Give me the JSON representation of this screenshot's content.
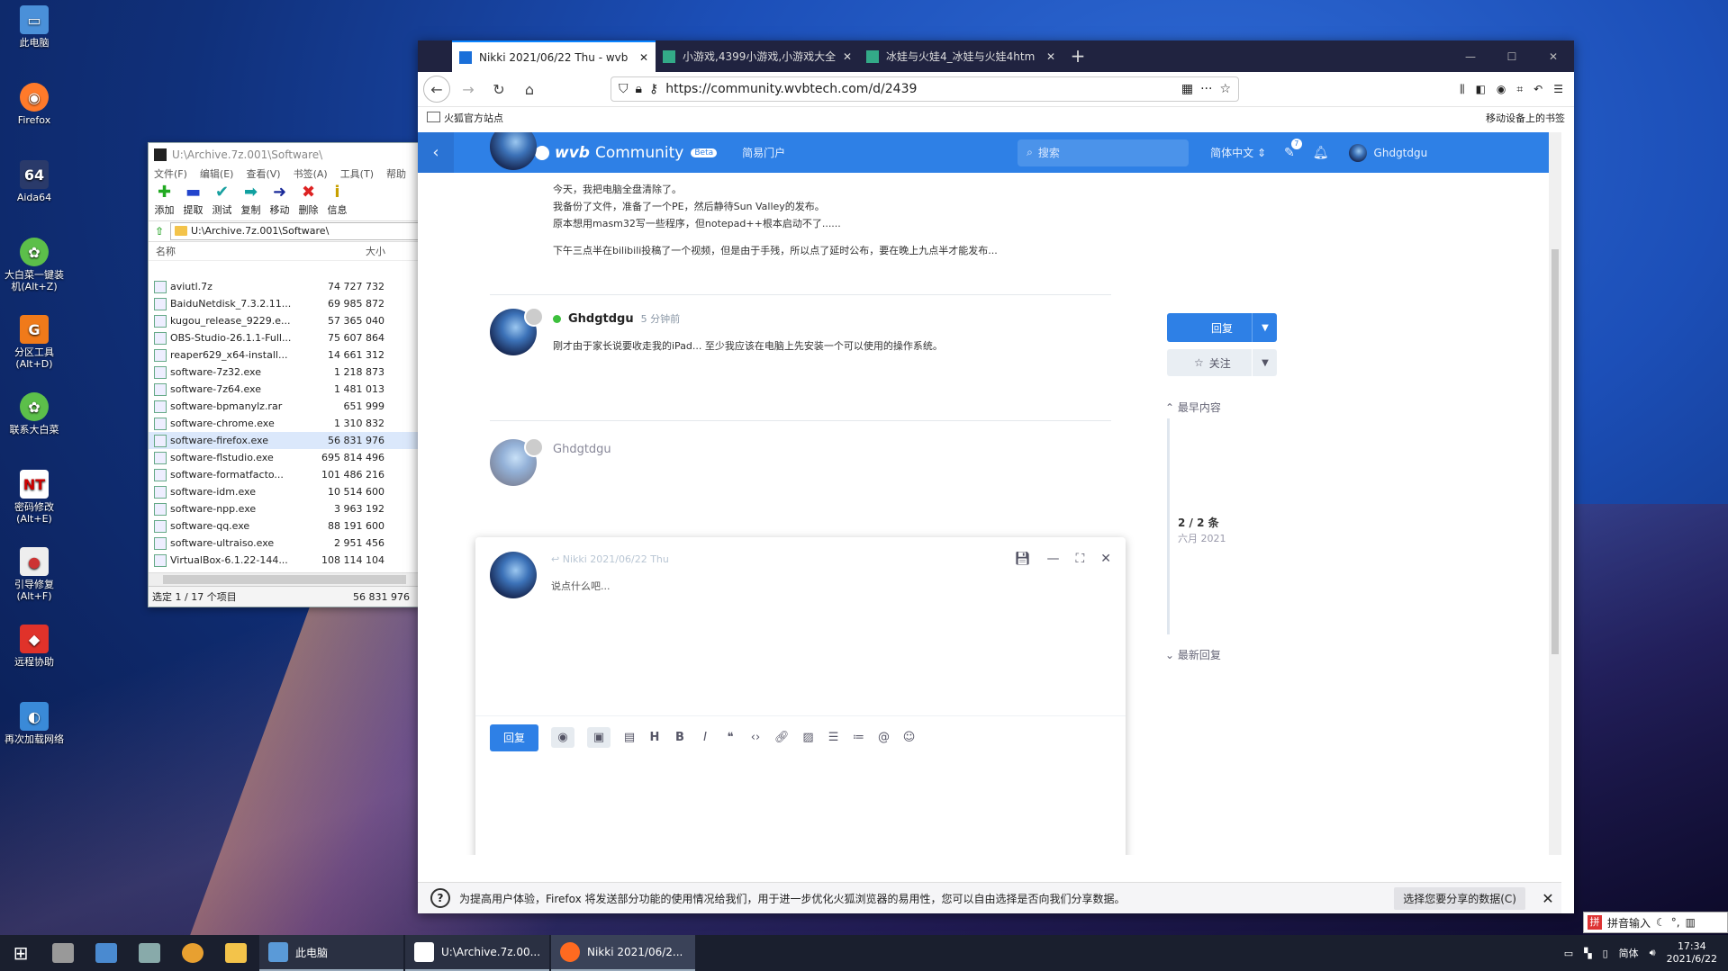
{
  "desktop": {
    "icons": [
      {
        "label": "此电脑"
      },
      {
        "label": "Firefox"
      },
      {
        "label": "Aida64"
      },
      {
        "label": "大白菜一键装机(Alt+Z)"
      },
      {
        "label": "分区工具(Alt+D)"
      },
      {
        "label": "联系大白菜"
      },
      {
        "label": "密码修改(Alt+E)"
      },
      {
        "label": "引导修复(Alt+F)"
      },
      {
        "label": "远程协助"
      },
      {
        "label": "再次加载网络"
      }
    ]
  },
  "zip": {
    "title": "U:\\Archive.7z.001\\Software\\",
    "menu": [
      "文件(F)",
      "编辑(E)",
      "查看(V)",
      "书签(A)",
      "工具(T)",
      "帮助"
    ],
    "tools": [
      {
        "label": "添加",
        "glyph": "✚",
        "color": "#22aa22"
      },
      {
        "label": "提取",
        "glyph": "▬",
        "color": "#2244cc"
      },
      {
        "label": "测试",
        "glyph": "✔",
        "color": "#18a0a0"
      },
      {
        "label": "复制",
        "glyph": "➡",
        "color": "#10a0a0"
      },
      {
        "label": "移动",
        "glyph": "➜",
        "color": "#1a2a99"
      },
      {
        "label": "删除",
        "glyph": "✖",
        "color": "#dd2222"
      },
      {
        "label": "信息",
        "glyph": "i",
        "color": "#c8a000"
      }
    ],
    "path": "U:\\Archive.7z.001\\Software\\",
    "col_name": "名称",
    "col_size": "大小",
    "files": [
      {
        "name": "aviutl.7z",
        "size": "74 727 732"
      },
      {
        "name": "BaiduNetdisk_7.3.2.11...",
        "size": "69 985 872"
      },
      {
        "name": "kugou_release_9229.e...",
        "size": "57 365 040"
      },
      {
        "name": "OBS-Studio-26.1.1-Full...",
        "size": "75 607 864"
      },
      {
        "name": "reaper629_x64-install...",
        "size": "14 661 312"
      },
      {
        "name": "software-7z32.exe",
        "size": "1 218 873"
      },
      {
        "name": "software-7z64.exe",
        "size": "1 481 013"
      },
      {
        "name": "software-bpmanylz.rar",
        "size": "651 999"
      },
      {
        "name": "software-chrome.exe",
        "size": "1 310 832"
      },
      {
        "name": "software-firefox.exe",
        "size": "56 831 976"
      },
      {
        "name": "software-flstudio.exe",
        "size": "695 814 496"
      },
      {
        "name": "software-formatfacto...",
        "size": "101 486 216"
      },
      {
        "name": "software-idm.exe",
        "size": "10 514 600"
      },
      {
        "name": "software-npp.exe",
        "size": "3 963 192"
      },
      {
        "name": "software-qq.exe",
        "size": "88 191 600"
      },
      {
        "name": "software-ultraiso.exe",
        "size": "2 951 456"
      },
      {
        "name": "VirtualBox-6.1.22-144...",
        "size": "108 114 104"
      }
    ],
    "status_left": "选定 1 / 17 个项目",
    "status_right": "56 831 976"
  },
  "browser": {
    "tabs": [
      {
        "title": "Nikki 2021/06/22 Thu - wvb",
        "active": true
      },
      {
        "title": "小游戏,4399小游戏,小游戏大全",
        "active": false
      },
      {
        "title": "冰娃与火娃4_冰娃与火娃4htm",
        "active": false
      }
    ],
    "url": "https://community.wvbtech.com/d/2439",
    "bookmark_left": "火狐官方站点",
    "bookmark_right": "移动设备上的书签",
    "notification": "为提高用户体验，Firefox 将发送部分功能的使用情况给我们，用于进一步优化火狐浏览器的易用性，您可以自由选择是否向我们分享数据。",
    "notification_button": "选择您要分享的数据(C)"
  },
  "forum": {
    "logo_bold": "wvb",
    "logo_rest": "Community",
    "beta": "Beta",
    "home": "简易门户",
    "search_placeholder": "搜索",
    "language": "简体中文",
    "notif_count": "7",
    "username": "Ghdgtdgu",
    "post1_lines": [
      "今天，我把电脑全盘清除了。",
      "我备份了文件，准备了一个PE，然后静待Sun Valley的发布。",
      "原本想用masm32写一些程序，但notepad++根本启动不了......"
    ],
    "post1_para2": "下午三点半在bilibili投稿了一个视频，但是由于手残，所以点了延时公布，要在晚上九点半才能发布...",
    "post2_user": "Ghdgtdgu",
    "post2_time": "5 分钟前",
    "post2_body": "刚才由于家长说要收走我的iPad... 至少我应该在电脑上先安装一个可以使用的操作系统。",
    "post3_user": "Ghdgtdgu",
    "reply_label": "回复",
    "follow_label": "关注",
    "earliest": "最早内容",
    "latest": "最新回复",
    "count": "2 / 2 条",
    "month": "六月 2021",
    "composer_title": "Nikki 2021/06/22 Thu",
    "composer_placeholder": "说点什么吧...",
    "composer_send": "回复"
  },
  "taskbar": {
    "tasks": [
      {
        "label": "此电脑",
        "color": "#5a9ad8"
      },
      {
        "label": "U:\\Archive.7z.00...",
        "color": "#222"
      },
      {
        "label": "Nikki 2021/06/2...",
        "color": "#ff6a20"
      }
    ],
    "ime_label": "拼音输入",
    "lang": "简体",
    "time": "17:34",
    "date": "2021/6/22"
  }
}
